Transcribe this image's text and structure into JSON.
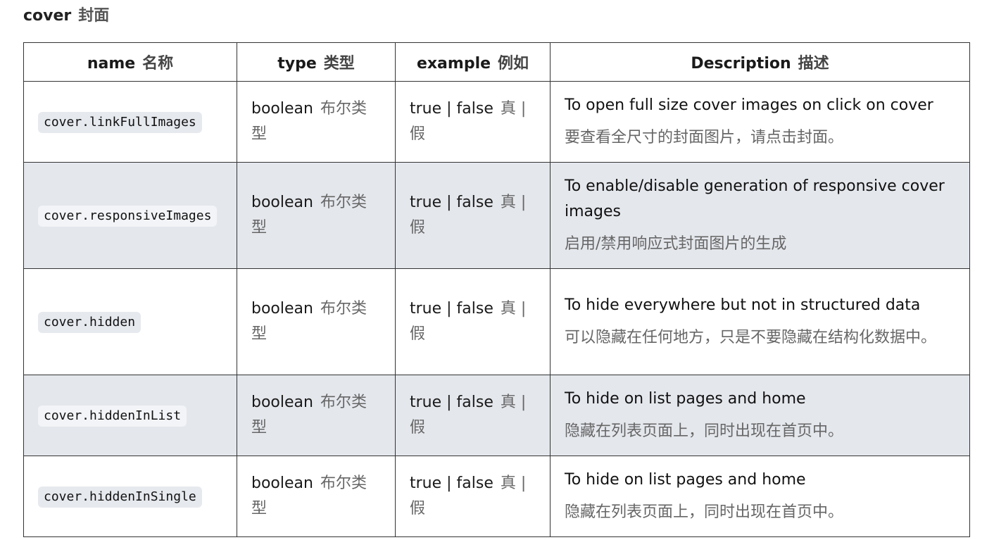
{
  "section": {
    "title": "cover",
    "title_zh": "封面"
  },
  "columns": [
    {
      "en": "name",
      "zh": "名称"
    },
    {
      "en": "type",
      "zh": "类型"
    },
    {
      "en": "example",
      "zh": "例如"
    },
    {
      "en": "Description",
      "zh": "描述"
    }
  ],
  "rows": [
    {
      "name": "cover.linkFullImages",
      "type": "boolean",
      "type_zh": "布尔类型",
      "example": "true | false",
      "example_zh": "真 | 假",
      "desc_en": "To open full size cover images on click on cover",
      "desc_zh": "要查看全尺寸的封面图片，请点击封面。"
    },
    {
      "name": "cover.responsiveImages",
      "type": "boolean",
      "type_zh": "布尔类型",
      "example": "true | false",
      "example_zh": "真 | 假",
      "desc_en": "To enable/disable generation of responsive cover images",
      "desc_zh": "启用/禁用响应式封面图片的生成"
    },
    {
      "name": "cover.hidden",
      "type": "boolean",
      "type_zh": "布尔类型",
      "example": "true | false",
      "example_zh": "真 | 假",
      "desc_en": "To hide everywhere but not in structured data",
      "desc_zh": "可以隐藏在任何地方，只是不要隐藏在结构化数据中。"
    },
    {
      "name": "cover.hiddenInList",
      "type": "boolean",
      "type_zh": "布尔类型",
      "example": "true | false",
      "example_zh": "真 | 假",
      "desc_en": "To hide on list pages and home",
      "desc_zh": "隐藏在列表页面上，同时出现在首页中。"
    },
    {
      "name": "cover.hiddenInSingle",
      "type": "boolean",
      "type_zh": "布尔类型",
      "example": "true | false",
      "example_zh": "真 | 假",
      "desc_en": "To hide on list pages and home",
      "desc_zh": "隐藏在列表页面上，同时出现在首页中。"
    }
  ]
}
